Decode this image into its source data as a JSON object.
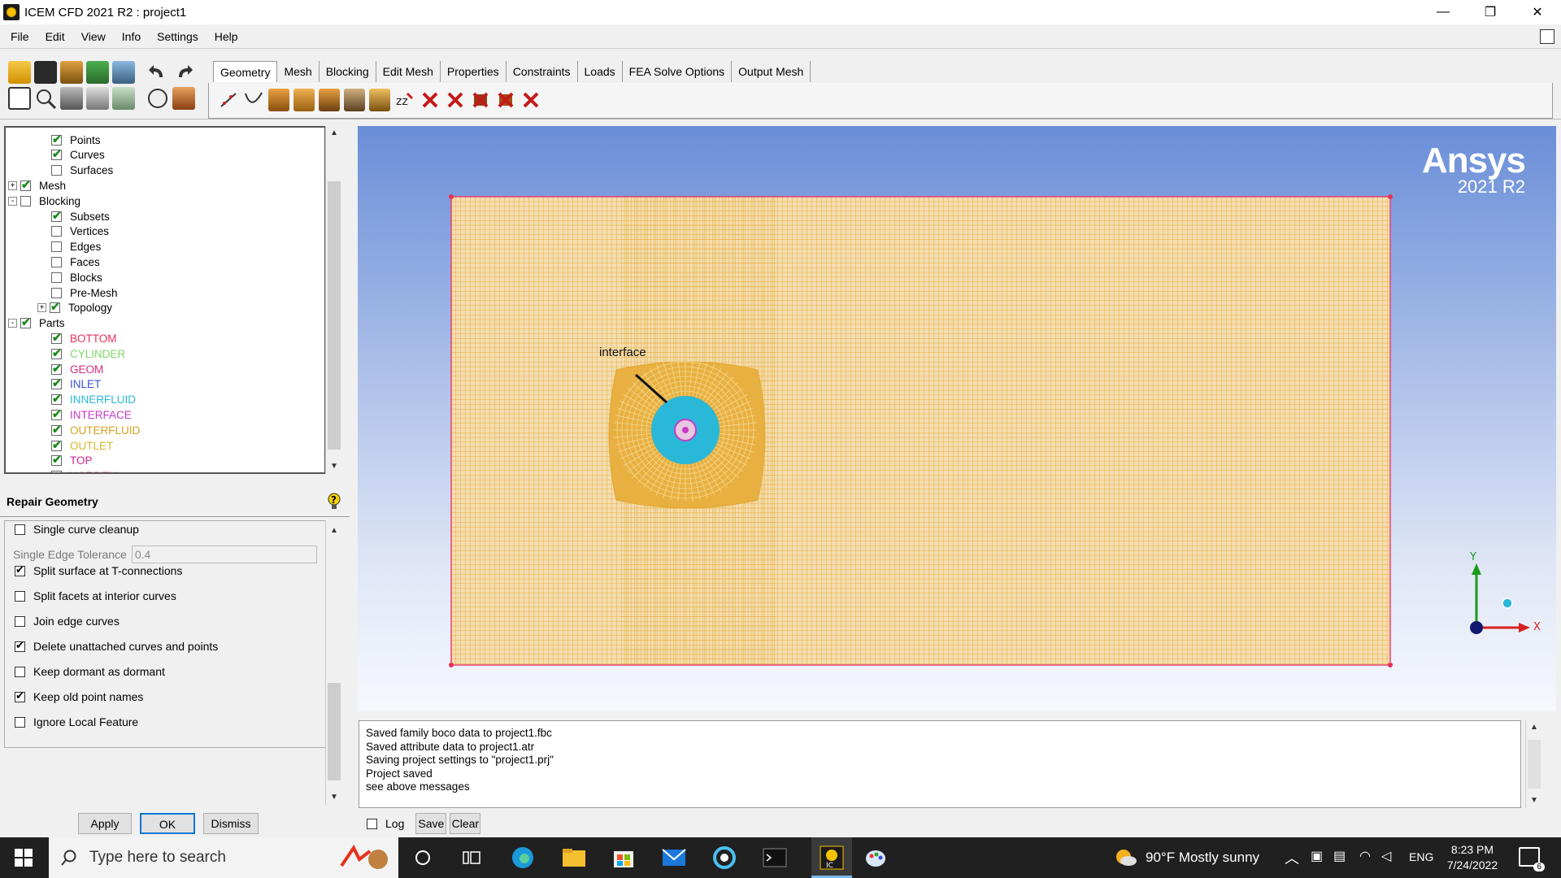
{
  "window": {
    "title": "ICEM CFD 2021 R2 : project1",
    "minimize": "—",
    "maximize": "❐",
    "close": "✕"
  },
  "menu": [
    "File",
    "Edit",
    "View",
    "Info",
    "Settings",
    "Help"
  ],
  "tabs": [
    "Geometry",
    "Mesh",
    "Blocking",
    "Edit Mesh",
    "Properties",
    "Constraints",
    "Loads",
    "FEA Solve Options",
    "Output Mesh"
  ],
  "tree": [
    {
      "label": "Points",
      "checked": true,
      "level": 2,
      "color": "#000000"
    },
    {
      "label": "Curves",
      "checked": true,
      "level": 2,
      "color": "#000000"
    },
    {
      "label": "Surfaces",
      "checked": false,
      "level": 2,
      "color": "#000000"
    },
    {
      "label": "Mesh",
      "checked": true,
      "level": 1,
      "expander": "+",
      "color": "#000000"
    },
    {
      "label": "Blocking",
      "checked": false,
      "level": 1,
      "expander": "-",
      "color": "#000000"
    },
    {
      "label": "Subsets",
      "checked": true,
      "level": 2,
      "color": "#000000"
    },
    {
      "label": "Vertices",
      "checked": false,
      "level": 2,
      "color": "#000000"
    },
    {
      "label": "Edges",
      "checked": false,
      "level": 2,
      "color": "#000000"
    },
    {
      "label": "Faces",
      "checked": false,
      "level": 2,
      "color": "#000000"
    },
    {
      "label": "Blocks",
      "checked": false,
      "level": 2,
      "color": "#000000"
    },
    {
      "label": "Pre-Mesh",
      "checked": false,
      "level": 2,
      "color": "#000000"
    },
    {
      "label": "Topology",
      "checked": true,
      "level": 2,
      "expander": "+",
      "color": "#000000"
    },
    {
      "label": "Parts",
      "checked": true,
      "level": 1,
      "expander": "-",
      "color": "#000000"
    },
    {
      "label": "BOTTOM",
      "checked": true,
      "level": 2,
      "color": "#e8305a"
    },
    {
      "label": "CYLINDER",
      "checked": true,
      "level": 2,
      "color": "#7fd86a"
    },
    {
      "label": "GEOM",
      "checked": true,
      "level": 2,
      "color": "#d6287e"
    },
    {
      "label": "INLET",
      "checked": true,
      "level": 2,
      "color": "#3a52d8"
    },
    {
      "label": "INNERFLUID",
      "checked": true,
      "level": 2,
      "color": "#2ab8d8"
    },
    {
      "label": "INTERFACE",
      "checked": true,
      "level": 2,
      "color": "#c83ac8"
    },
    {
      "label": "OUTERFLUID",
      "checked": true,
      "level": 2,
      "color": "#d8a020"
    },
    {
      "label": "OUTLET",
      "checked": true,
      "level": 2,
      "color": "#d8b830"
    },
    {
      "label": "TOP",
      "checked": true,
      "level": 2,
      "color": "#d02890"
    },
    {
      "label": "VORDEN",
      "checked": false,
      "level": 2,
      "color": "#d84040"
    }
  ],
  "repair": {
    "title": "Repair Geometry",
    "tolerance_label": "Single Edge Tolerance",
    "tolerance_value": "0.4",
    "options": [
      {
        "label": "Single curve cleanup",
        "checked": false
      },
      {
        "label": "Split surface at T-connections",
        "checked": true
      },
      {
        "label": "Split facets at interior curves",
        "checked": false
      },
      {
        "label": "Join edge curves",
        "checked": false
      },
      {
        "label": "Delete unattached curves and points",
        "checked": true
      },
      {
        "label": "Keep dormant as dormant",
        "checked": false
      },
      {
        "label": "Keep old point names",
        "checked": true
      },
      {
        "label": "Ignore Local Feature",
        "checked": false
      }
    ],
    "apply": "Apply",
    "ok": "OK",
    "dismiss": "Dismiss"
  },
  "viewport": {
    "brand": "Ansys",
    "version": "2021 R2",
    "annotation": "interface",
    "axis_x": "X",
    "axis_y": "Y",
    "mesh_color": "#e8b040",
    "cylinder_color": "#2ab8d8"
  },
  "messages": [
    "Saved family boco data to project1.fbc",
    "Saved attribute data to project1.atr",
    "Saving project settings to \"project1.prj\"",
    "Project saved",
    "see above messages"
  ],
  "msgctrl": {
    "log": "Log",
    "save": "Save",
    "clear": "Clear"
  },
  "taskbar": {
    "search_placeholder": "Type here to search",
    "weather": "90°F  Mostly sunny",
    "lang": "ENG",
    "time": "8:23 PM",
    "date": "7/24/2022",
    "notif_count": "6"
  }
}
